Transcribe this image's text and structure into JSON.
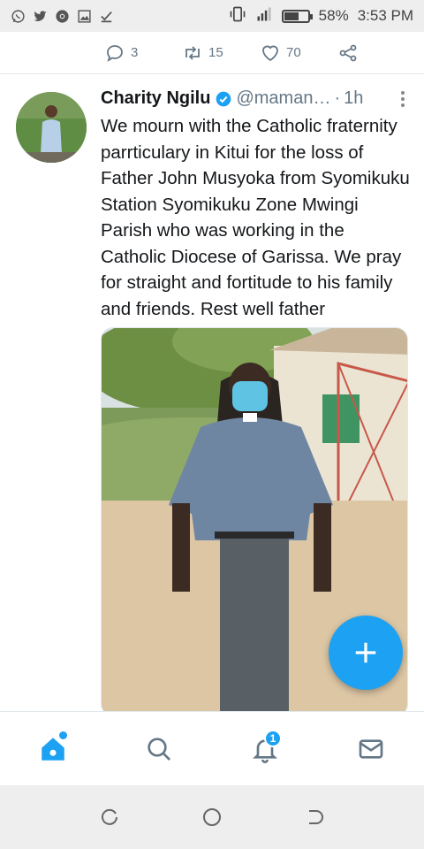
{
  "status_bar": {
    "battery": "58%",
    "battery_level": 0.58,
    "time": "3:53 PM",
    "notification_icons": [
      "whatsapp-icon",
      "twitter-icon",
      "chrome-icon",
      "gallery-icon",
      "download-done-icon"
    ],
    "system_icons": [
      "vibrate-icon",
      "signal-icon",
      "battery-icon"
    ]
  },
  "previous_tweet": {
    "reply_count": "3",
    "retweet_count": "15",
    "like_count": "70"
  },
  "tweet": {
    "name": "Charity Ngilu",
    "handle": "@maman…",
    "time_sep": "·",
    "time": "1h",
    "text": "We mourn with the Catholic fraternity parrticulary in Kitui for the loss of Father John Musyoka from Syomikuku Station Syomikuku Zone Mwingi Parish who was working in the Catholic Diocese of Garissa. We pray for straight and fortitude to his family and friends. Rest well father"
  },
  "bottom_nav": {
    "notification_badge": "1",
    "items": [
      "home-icon",
      "search-icon",
      "notifications-icon",
      "messages-icon"
    ]
  },
  "colors": {
    "accent": "#1da1f2",
    "text": "#14171a",
    "secondary_text": "#657786"
  }
}
